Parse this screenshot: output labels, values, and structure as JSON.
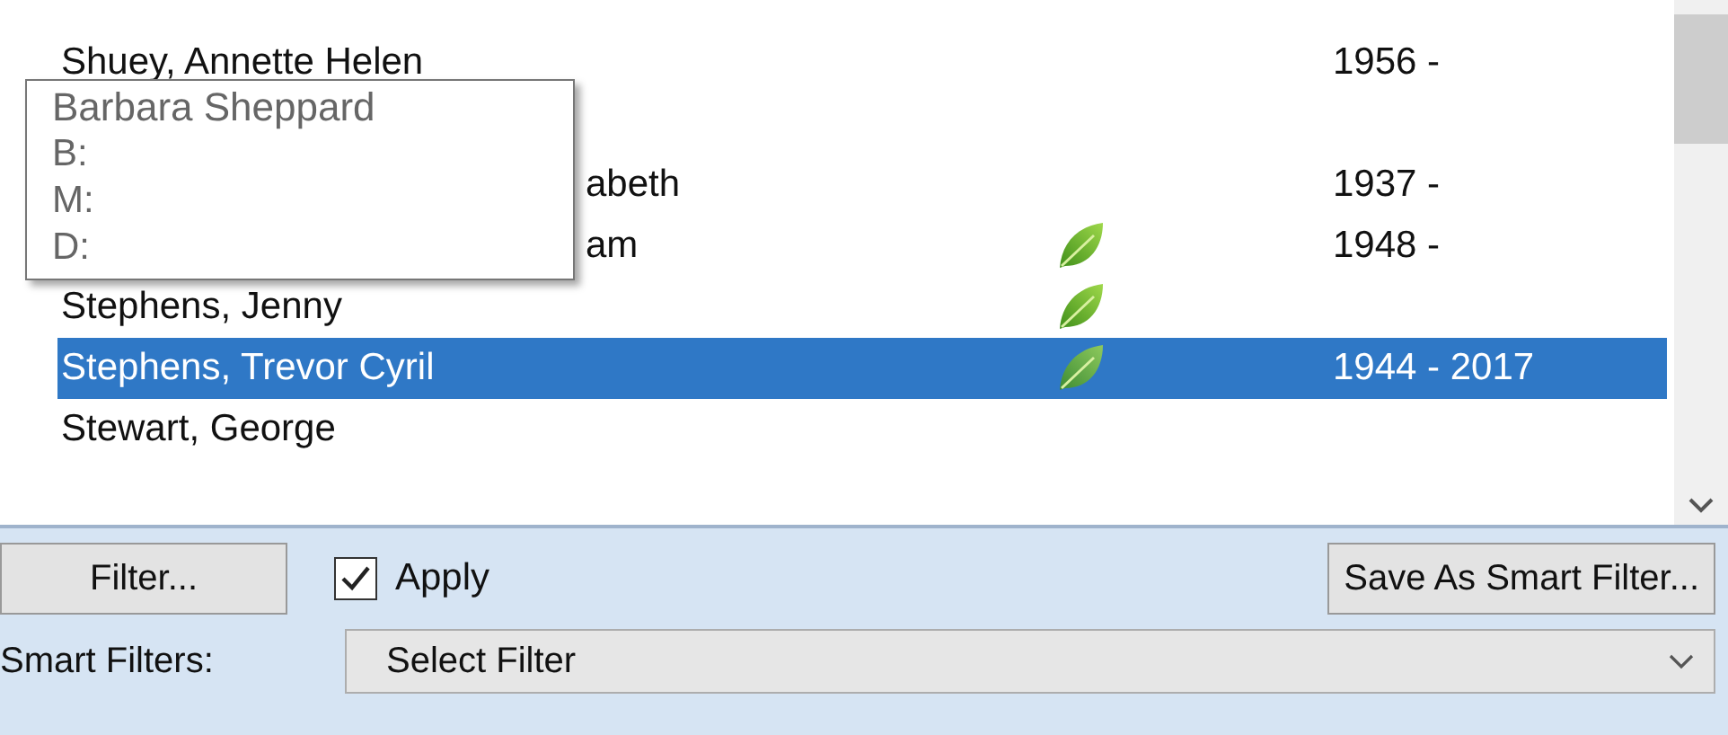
{
  "people": [
    {
      "kind": "full",
      "name": "Shuey, Annette Helen",
      "leaf": false,
      "dates": "1956 -",
      "selected": false
    },
    {
      "kind": "covered",
      "leaf": false,
      "selected": false
    },
    {
      "kind": "partial",
      "name": "abeth",
      "leaf": false,
      "dates": "1937 -",
      "selected": false
    },
    {
      "kind": "partial",
      "name": "am",
      "leaf": true,
      "dates": "1948 -",
      "selected": false
    },
    {
      "kind": "full",
      "name": "Stephens, Jenny",
      "leaf": true,
      "selected": false
    },
    {
      "kind": "full",
      "name": "Stephens, Trevor Cyril",
      "leaf": true,
      "dates": "1944 - 2017",
      "selected": true
    },
    {
      "kind": "full",
      "name": "Stewart, George",
      "leaf": false,
      "selected": false
    }
  ],
  "tooltip": {
    "title": "Barbara Sheppard",
    "lines": [
      "B:",
      "M:",
      "D:"
    ]
  },
  "filter_button": "Filter...",
  "apply": {
    "label": "Apply",
    "checked": true
  },
  "save_button": "Save As Smart Filter...",
  "smart_filters": {
    "label": "Smart Filters:",
    "value": "Select Filter"
  }
}
